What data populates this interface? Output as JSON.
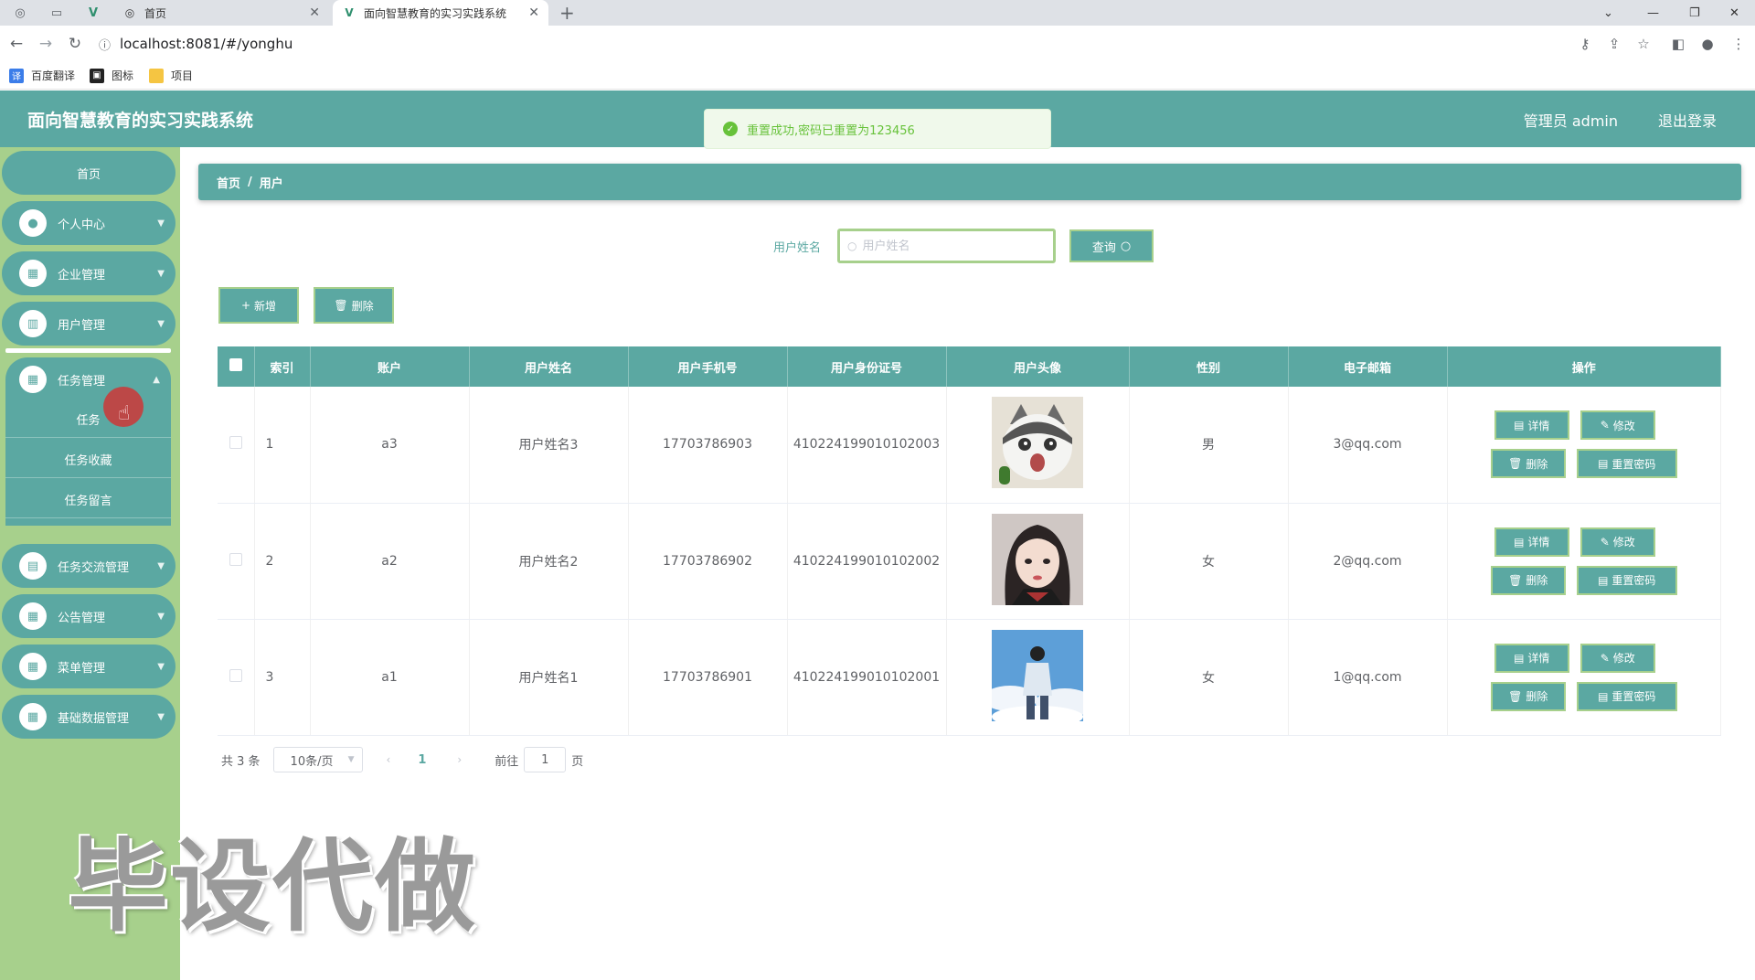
{
  "browser": {
    "tabs": [
      {
        "title": "首页",
        "active": false
      },
      {
        "title": "面向智慧教育的实习实践系统",
        "active": true
      }
    ],
    "url": "localhost:8081/#/yonghu",
    "bookmarks": [
      "百度翻译",
      "图标",
      "项目"
    ]
  },
  "header": {
    "title": "面向智慧教育的实习实践系统",
    "user": "管理员 admin",
    "logout": "退出登录"
  },
  "toast": {
    "message": "重置成功,密码已重置为123456"
  },
  "sidebar": {
    "home": "首页",
    "items": [
      {
        "label": "个人中心",
        "icon": "user-icon"
      },
      {
        "label": "企业管理",
        "icon": "grid-icon"
      },
      {
        "label": "用户管理",
        "icon": "chart-icon"
      },
      {
        "label": "任务管理",
        "icon": "grid-icon"
      },
      {
        "label": "任务交流管理",
        "icon": "doc-icon"
      },
      {
        "label": "公告管理",
        "icon": "grid-icon"
      },
      {
        "label": "菜单管理",
        "icon": "grid-icon"
      },
      {
        "label": "基础数据管理",
        "icon": "grid-icon"
      }
    ],
    "submenu": [
      "任务",
      "任务收藏",
      "任务留言"
    ]
  },
  "watermark": "毕设代做",
  "breadcrumb": [
    "首页",
    "用户"
  ],
  "search": {
    "label": "用户姓名",
    "placeholder": "用户姓名",
    "button": "查询"
  },
  "actions": {
    "add": "新增",
    "delete": "删除"
  },
  "table": {
    "columns": [
      "索引",
      "账户",
      "用户姓名",
      "用户手机号",
      "用户身份证号",
      "用户头像",
      "性别",
      "电子邮箱",
      "操作"
    ],
    "rows": [
      {
        "index": "1",
        "account": "a3",
        "name": "用户姓名3",
        "phone": "17703786903",
        "id_card": "410224199010102003",
        "avatar": "cat",
        "gender": "男",
        "email": "3@qq.com"
      },
      {
        "index": "2",
        "account": "a2",
        "name": "用户姓名2",
        "phone": "17703786902",
        "id_card": "410224199010102002",
        "avatar": "girl",
        "gender": "女",
        "email": "2@qq.com"
      },
      {
        "index": "3",
        "account": "a1",
        "name": "用户姓名1",
        "phone": "17703786901",
        "id_card": "410224199010102001",
        "avatar": "sky",
        "gender": "女",
        "email": "1@qq.com"
      }
    ],
    "ops": {
      "detail": "详情",
      "edit": "修改",
      "delete": "删除",
      "reset": "重置密码"
    }
  },
  "pagination": {
    "total": "共 3 条",
    "page_size": "10条/页",
    "current": "1",
    "goto_label": "前往",
    "goto_value": "1",
    "page_suffix": "页"
  },
  "colors": {
    "primary": "#5ba8a2",
    "sidebar": "#a7d08c",
    "success": "#67c23a"
  }
}
